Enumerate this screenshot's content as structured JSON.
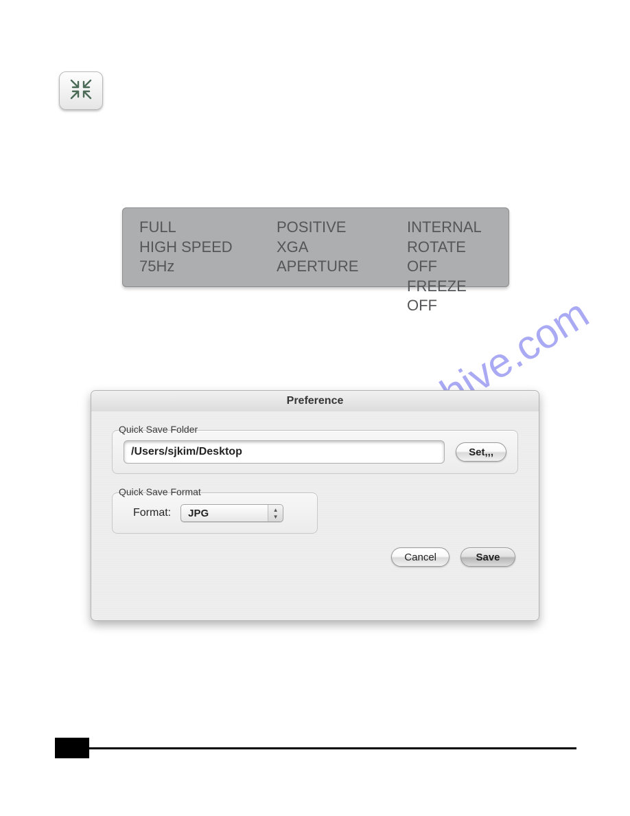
{
  "toolbar": {
    "collapse_icon": "collapse-icon"
  },
  "lcd": {
    "col1": {
      "r1": "FULL",
      "r2": "HIGH SPEED",
      "r3": "75Hz"
    },
    "col2": {
      "r1": "POSITIVE",
      "r2": "XGA",
      "r3": "APERTURE"
    },
    "col3": {
      "r1": "INTERNAL",
      "r2": "ROTATE OFF",
      "r3": "FREEZE OFF"
    }
  },
  "watermark": "manualshive.com",
  "dialog": {
    "title": "Preference",
    "quick_save_folder": {
      "label": "Quick Save Folder",
      "value": "/Users/sjkim/Desktop",
      "set_label": "Set,,,"
    },
    "quick_save_format": {
      "label": "Quick Save Format",
      "field_label": "Format:",
      "value": "JPG"
    },
    "cancel_label": "Cancel",
    "save_label": "Save"
  }
}
